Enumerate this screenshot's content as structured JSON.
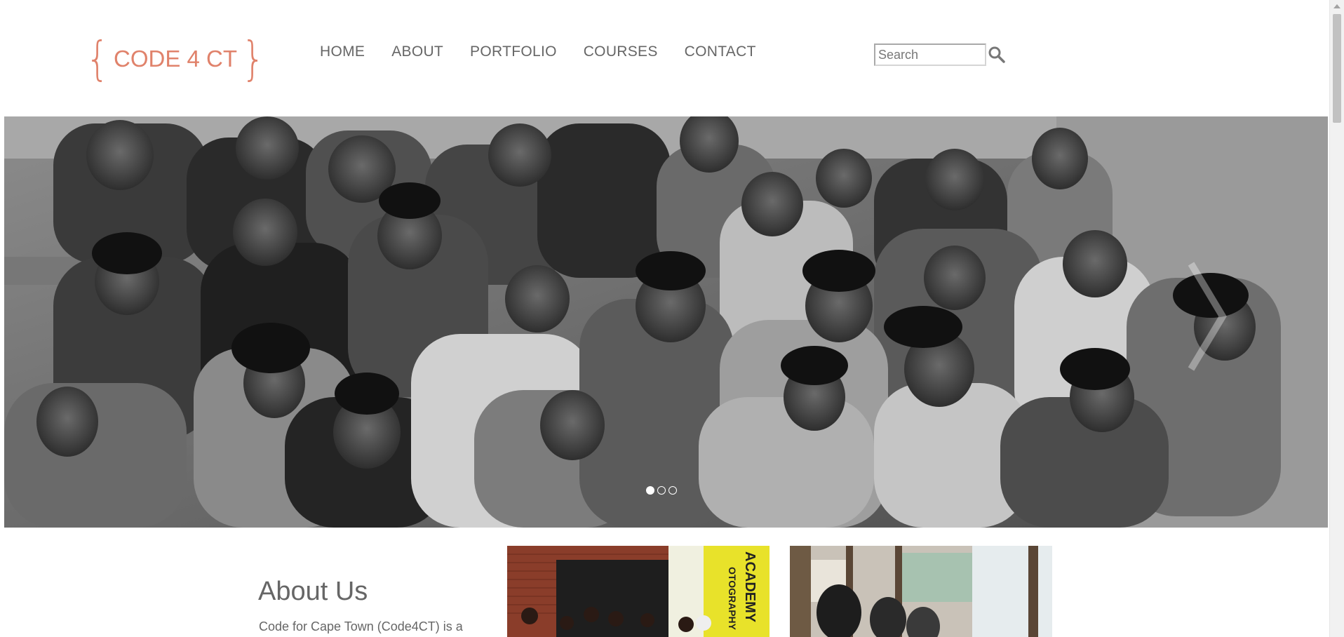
{
  "logo": {
    "text": "CODE 4 CT",
    "brace_open": "{",
    "brace_close": "}",
    "color": "#e0826b"
  },
  "nav": {
    "items": [
      {
        "label": "HOME"
      },
      {
        "label": "ABOUT"
      },
      {
        "label": "PORTFOLIO"
      },
      {
        "label": "COURSES"
      },
      {
        "label": "CONTACT"
      }
    ]
  },
  "search": {
    "placeholder": "Search",
    "icon": "search-icon"
  },
  "hero": {
    "slide_count": 3,
    "active_slide": 1,
    "next_icon": "chevron-right-icon"
  },
  "about": {
    "heading": "About Us",
    "text": "Code for Cape Town (Code4CT) is a"
  },
  "thumbnails": [
    {
      "caption": "ACADEMY",
      "caption2": "OTOGRAPHY"
    },
    {
      "caption": ""
    }
  ],
  "colors": {
    "text": "#666666",
    "accent": "#e0826b"
  }
}
